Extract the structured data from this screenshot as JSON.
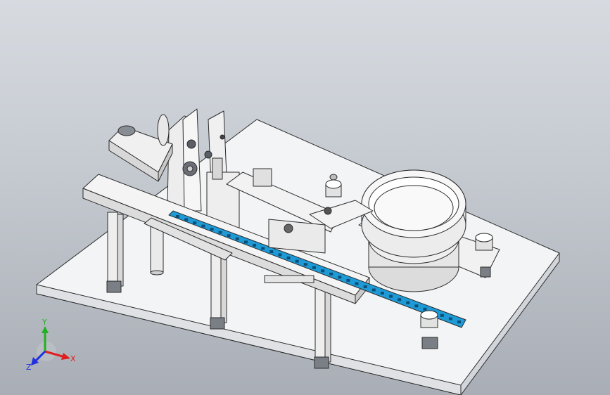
{
  "window": {
    "title": ""
  },
  "viewport": {
    "background_top": "#d7dbe0",
    "background_bottom": "#a9aeb6",
    "model_fill": "#f2f2f2",
    "edge_color": "#2b2b2b",
    "accent_conveyor": "#1e9ad6"
  },
  "triad": {
    "x_label": "X",
    "y_label": "Y",
    "z_label": "Z",
    "x_color": "#e02020",
    "y_color": "#20b020",
    "z_color": "#2030e0"
  },
  "components": {
    "base_plate": "base-plate",
    "linear_rail": "linear-rail",
    "conveyor_belt": "conveyor-belt",
    "servo_motor": "servo-motor",
    "vertical_mount": "vertical-mount",
    "vibratory_bowl_feeder": "vibratory-bowl-feeder"
  }
}
